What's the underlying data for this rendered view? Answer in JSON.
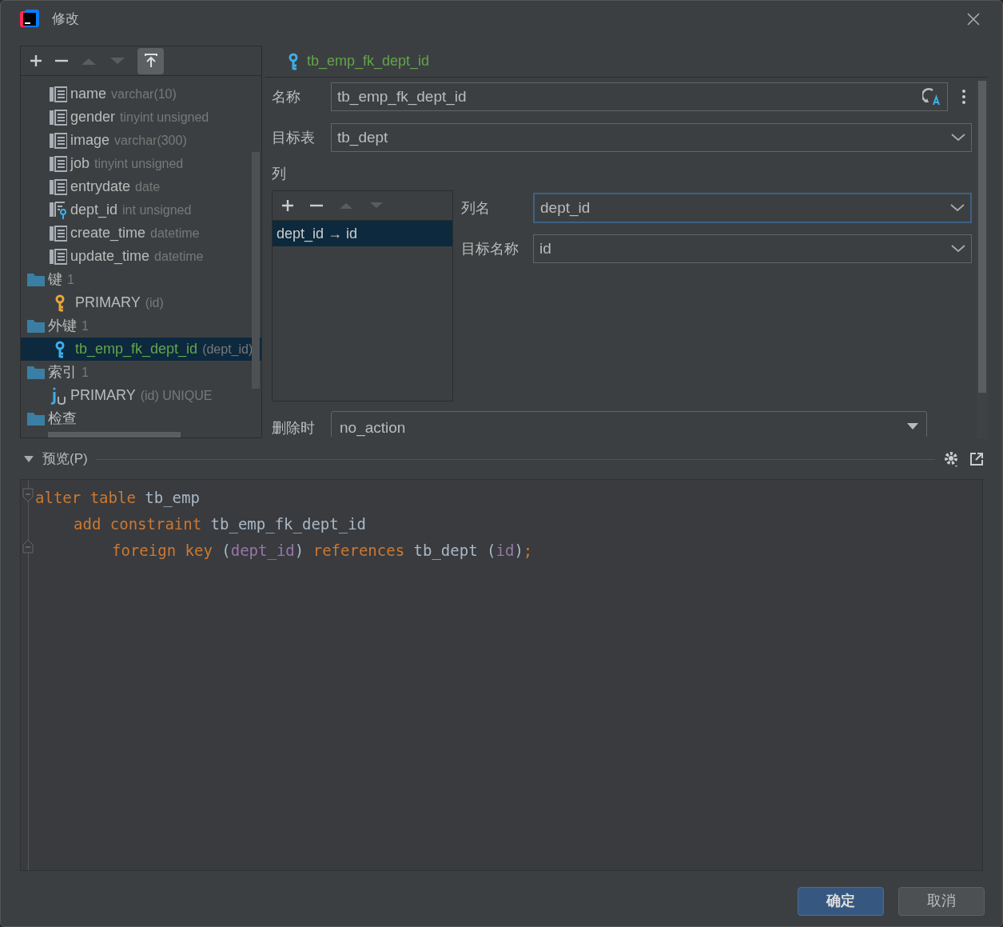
{
  "window": {
    "title": "修改"
  },
  "tree": {
    "items": [
      {
        "kind": "column",
        "name": "name",
        "detail": "varchar(10)",
        "selected": false
      },
      {
        "kind": "column",
        "name": "gender",
        "detail": "tinyint unsigned",
        "selected": false
      },
      {
        "kind": "column",
        "name": "image",
        "detail": "varchar(300)",
        "selected": false
      },
      {
        "kind": "column",
        "name": "job",
        "detail": "tinyint unsigned",
        "selected": false
      },
      {
        "kind": "column",
        "name": "entrydate",
        "detail": "date",
        "selected": false
      },
      {
        "kind": "fk-column",
        "name": "dept_id",
        "detail": "int unsigned",
        "selected": false
      },
      {
        "kind": "column",
        "name": "create_time",
        "detail": "datetime",
        "selected": false
      },
      {
        "kind": "column",
        "name": "update_time",
        "detail": "datetime",
        "selected": false
      },
      {
        "kind": "folder",
        "name": "键",
        "detail": "1",
        "selected": false,
        "children": [
          {
            "kind": "primary-key",
            "name": "PRIMARY",
            "detail": "(id)",
            "selected": false
          }
        ]
      },
      {
        "kind": "folder",
        "name": "外键",
        "detail": "1",
        "selected": false,
        "children": [
          {
            "kind": "foreign-key",
            "name": "tb_emp_fk_dept_id",
            "detail": "(dept_id)",
            "selected": true
          }
        ]
      },
      {
        "kind": "folder",
        "name": "索引",
        "detail": "1",
        "selected": false,
        "children": [
          {
            "kind": "index",
            "name": "PRIMARY",
            "detail": "(id) UNIQUE",
            "selected": false
          }
        ]
      },
      {
        "kind": "folder",
        "name": "检查",
        "selected": false
      }
    ]
  },
  "editor": {
    "header": "tb_emp_fk_dept_id",
    "name_label": "名称",
    "name_value": "tb_emp_fk_dept_id",
    "target_table_label": "目标表",
    "target_table_value": "tb_dept",
    "columns_label": "列",
    "mappings": [
      {
        "text": "dept_id → id",
        "selected": true
      }
    ],
    "column_name_label": "列名",
    "column_name_value": "dept_id",
    "target_name_label": "目标名称",
    "target_name_value": "id",
    "on_delete_label": "删除时",
    "on_delete_value": "no_action"
  },
  "preview": {
    "label": "预览(P)",
    "expanded": true,
    "lines": [
      {
        "tokens": [
          {
            "kind": "keyword",
            "text": "alter table "
          },
          {
            "kind": "plain",
            "text": "tb_emp"
          }
        ],
        "children": [
          {
            "tokens": [
              {
                "kind": "keyword",
                "text": "add constraint "
              },
              {
                "kind": "plain",
                "text": "tb_emp_fk_dept_id"
              }
            ],
            "children": [
              {
                "tokens": [
                  {
                    "kind": "keyword",
                    "text": "foreign key "
                  },
                  {
                    "kind": "plain",
                    "text": "("
                  },
                  {
                    "kind": "column",
                    "text": "dept_id"
                  },
                  {
                    "kind": "plain",
                    "text": ") "
                  },
                  {
                    "kind": "keyword",
                    "text": "references "
                  },
                  {
                    "kind": "plain",
                    "text": "tb_dept ("
                  },
                  {
                    "kind": "column",
                    "text": "id"
                  },
                  {
                    "kind": "plain",
                    "text": ")"
                  },
                  {
                    "kind": "keyword",
                    "text": ";"
                  }
                ]
              }
            ]
          }
        ]
      }
    ]
  },
  "buttons": [
    {
      "label": "确定",
      "kind": "primary"
    },
    {
      "label": "取消",
      "kind": "secondary"
    }
  ]
}
